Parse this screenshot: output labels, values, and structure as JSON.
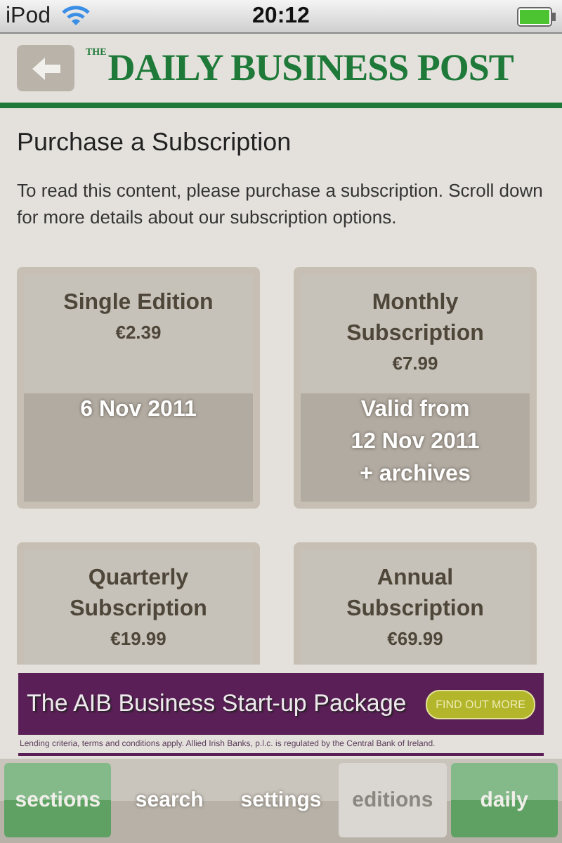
{
  "status_bar": {
    "carrier": "iPod",
    "time": "20:12"
  },
  "header": {
    "logo_small": "THE",
    "logo": "DAILY BUSINESS POST"
  },
  "page": {
    "title": "Purchase a Subscription",
    "intro": "To read this content, please purchase a subscription. Scroll down for more details about our subscription options."
  },
  "options": [
    {
      "name": "Single Edition",
      "price": "€2.39",
      "details": [
        "6 Nov 2011"
      ]
    },
    {
      "name": "Monthly Subscription",
      "price": "€7.99",
      "details": [
        "Valid from",
        "12 Nov 2011",
        "+ archives"
      ]
    },
    {
      "name": "Quarterly Subscription",
      "price": "€19.99"
    },
    {
      "name": "Annual Subscription",
      "price": "€69.99"
    }
  ],
  "ad": {
    "headline": "The AIB Business Start-up Package",
    "button": "FIND OUT MORE",
    "disclaimer": "Lending criteria, terms and conditions apply. Allied Irish Banks, p.l.c. is regulated by the Central Bank of Ireland."
  },
  "tabs": [
    {
      "label": "sections",
      "kind": "accent",
      "selected": false
    },
    {
      "label": "search",
      "kind": "plain",
      "selected": false
    },
    {
      "label": "settings",
      "kind": "plain",
      "selected": false
    },
    {
      "label": "editions",
      "kind": "plain",
      "selected": true
    },
    {
      "label": "daily",
      "kind": "accent",
      "selected": false
    }
  ]
}
